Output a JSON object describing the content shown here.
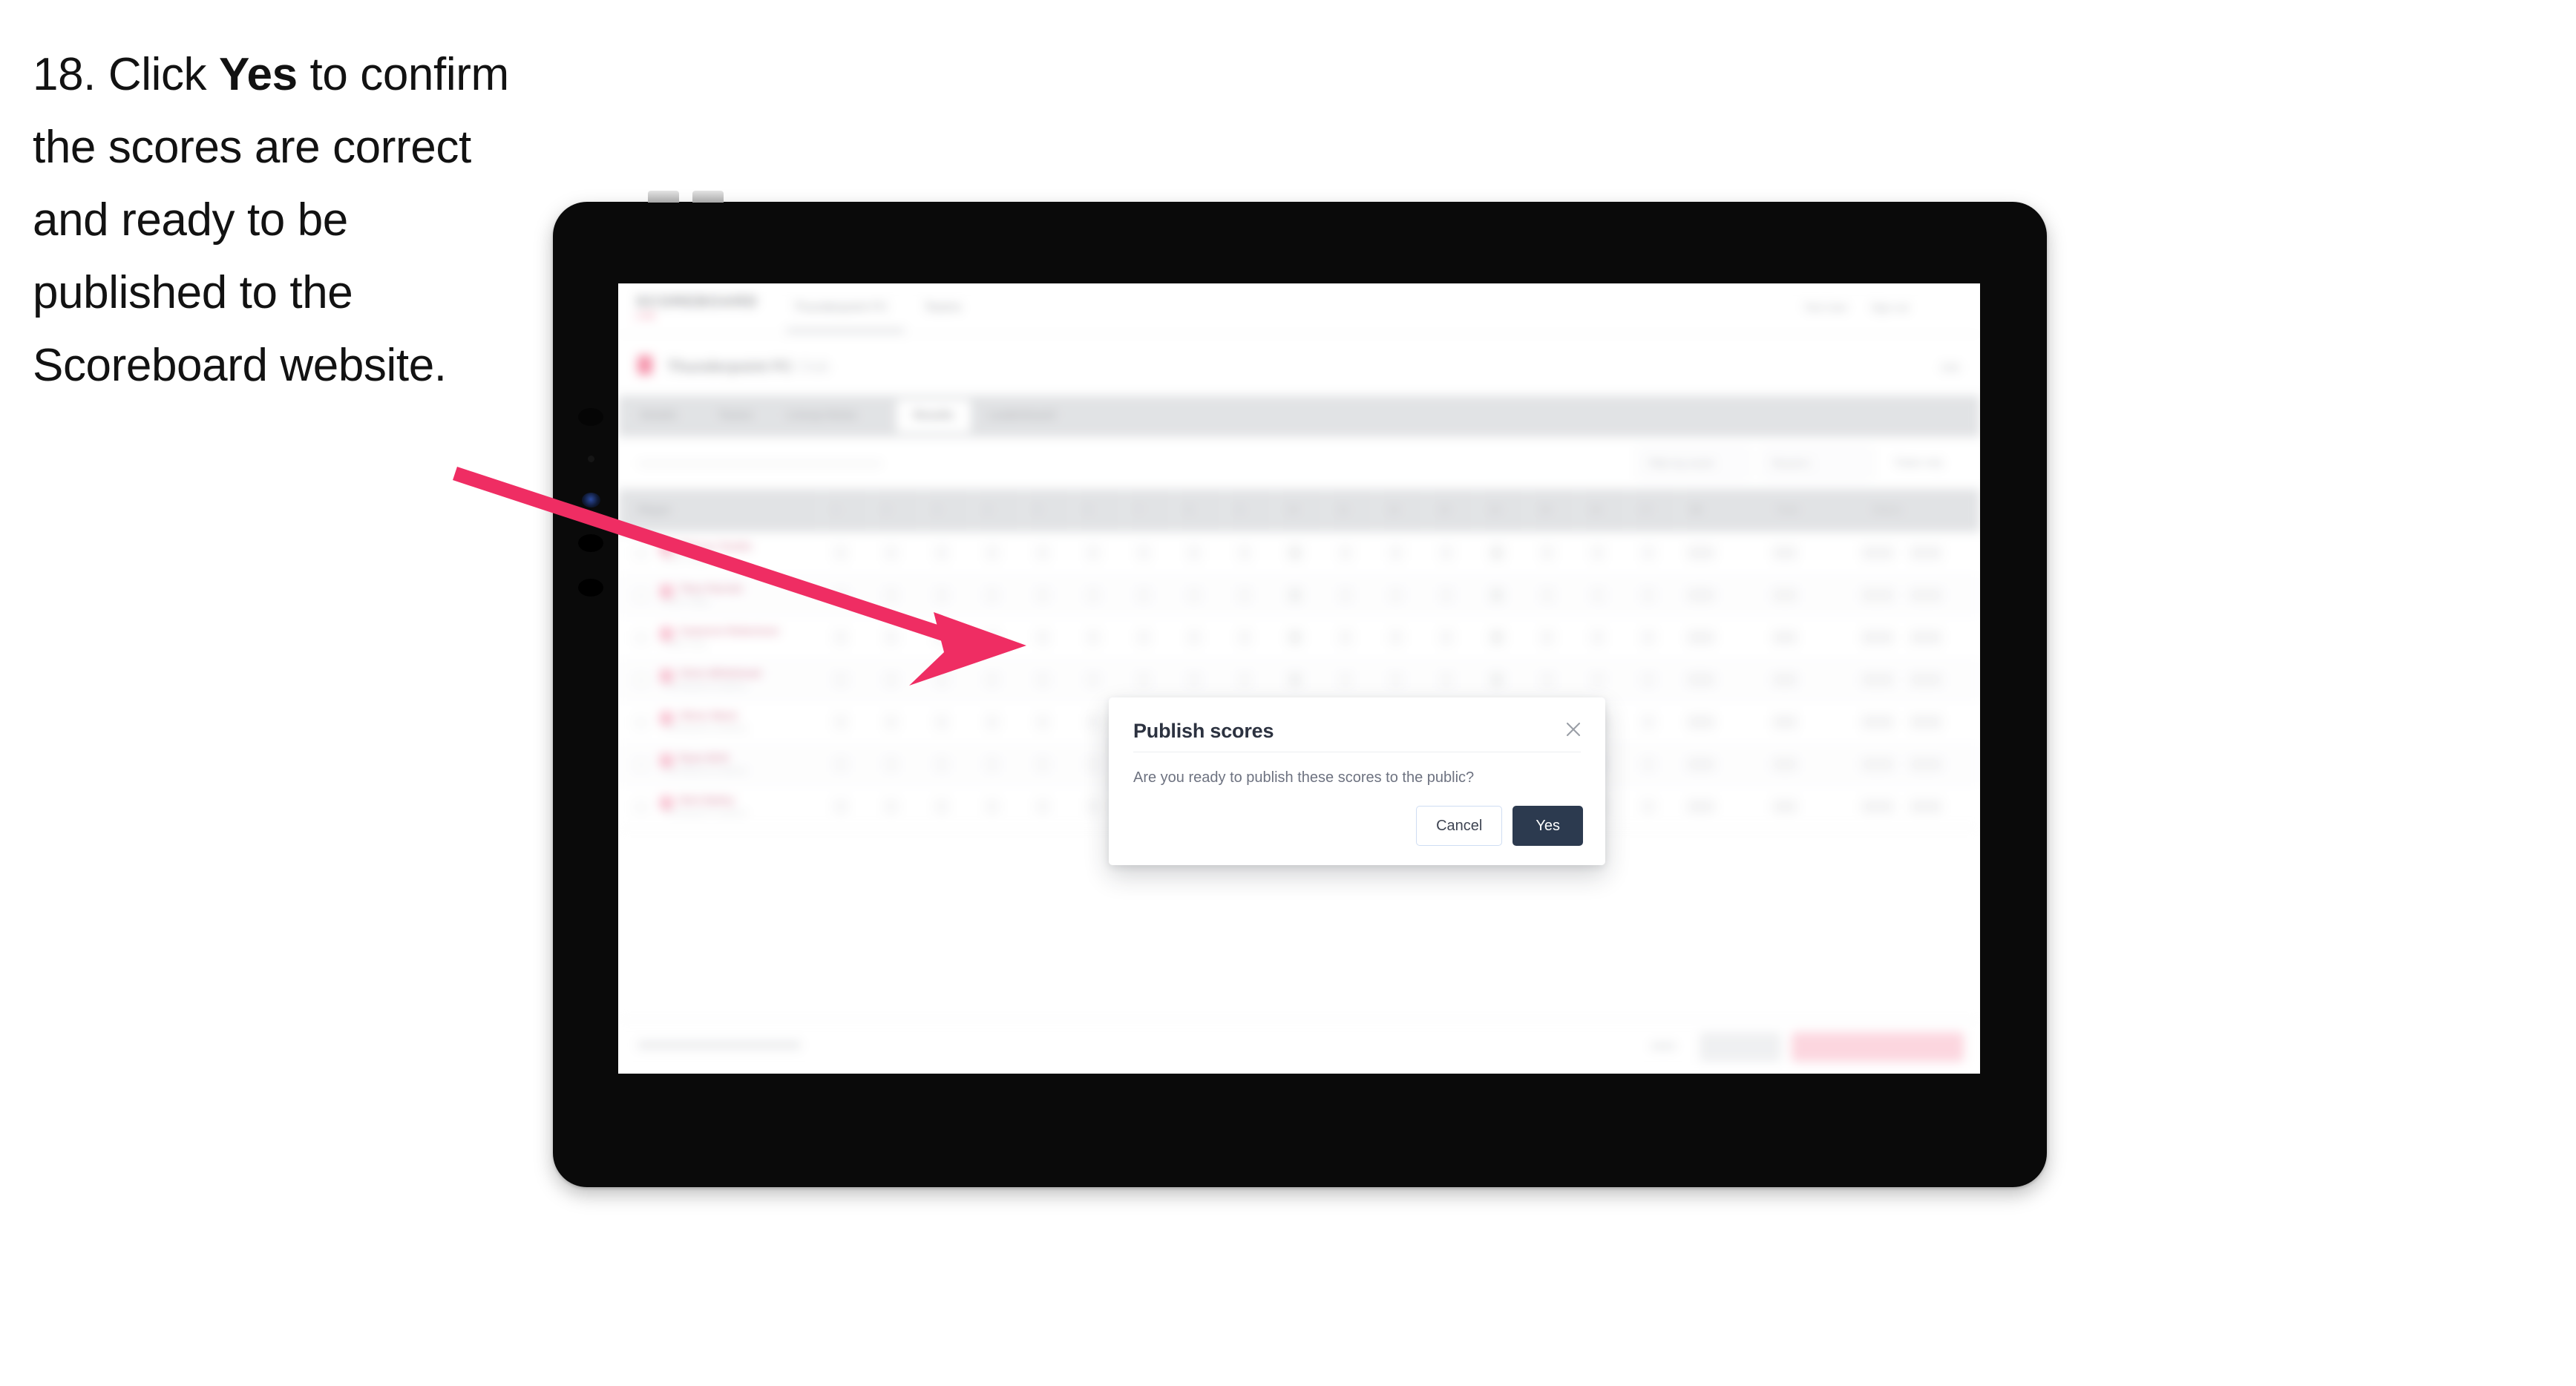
{
  "caption": {
    "number": "18.",
    "prefix": "Click ",
    "emphasis": "Yes",
    "rest": " to confirm the scores are correct and ready to be published to the Scoreboard website."
  },
  "colors": {
    "accent_pink": "#ef2d63",
    "modal_primary": "#2c3a4f",
    "modal_cancel_border": "#cfddf3",
    "brand_pink": "#e8446d",
    "tab_bar_grey": "#d5d7da",
    "device_body": "#0a0a0a",
    "device_rim": "#bdbdbd"
  },
  "device": {
    "type": "tablet",
    "orientation": "landscape"
  },
  "app": {
    "nav": {
      "logo": "SCOREBOARD",
      "logo_sub": "LIVE",
      "links": [
        "Thunderpoint FC",
        "Teams"
      ],
      "right_items": [
        "Test User",
        "Sign out"
      ]
    },
    "title_bar": {
      "title": "Thunderpoint FC",
      "title_faint": "Club",
      "right_action": "Edit"
    },
    "tabs": [
      {
        "label": "Details",
        "active": false
      },
      {
        "label": "Teams",
        "active": false
      },
      {
        "label": "Lineup Notes",
        "active": false
      },
      {
        "label": "Results",
        "active": true
      },
      {
        "label": "Leaderboard",
        "active": false
      }
    ],
    "filters": {
      "search_placeholder": "Search players",
      "pills": [
        "Filter by event",
        "Round 1",
        "Totals only"
      ]
    },
    "table": {
      "columns": [
        "Player",
        "1",
        "2",
        "3",
        "4",
        "5",
        "6",
        "7",
        "8",
        "9",
        "10",
        "11",
        "12",
        "13",
        "14",
        "15",
        "16",
        "17",
        "18",
        "In",
        "Total",
        "Status"
      ],
      "rows": [
        {
          "name": "Marcus Tomlin",
          "team": "Green Valley"
        },
        {
          "name": "Theo Parrish",
          "team": "Green Valley"
        },
        {
          "name": "Cameron Robertson",
          "team": "Parker Park"
        },
        {
          "name": "Chris Whitehead",
          "team": "Thunderpoint Academy"
        },
        {
          "name": "Oliver Mack",
          "team": "Thunderpoint Academy"
        },
        {
          "name": "Ryan Britt",
          "team": "Thunderpoint Academy"
        },
        {
          "name": "Nick Bailey",
          "team": "Thunderpoint Academy"
        }
      ]
    },
    "bottom_bar": {
      "note": "Scores published successfully",
      "buttons": [
        "Save all",
        "Publish scores to public"
      ]
    }
  },
  "modal": {
    "title": "Publish scores",
    "body": "Are you ready to publish these scores to the public?",
    "close_icon": "close-icon",
    "cancel_label": "Cancel",
    "confirm_label": "Yes"
  },
  "annotation": {
    "type": "arrow",
    "color": "#ef2d63",
    "points_to": "modal"
  }
}
